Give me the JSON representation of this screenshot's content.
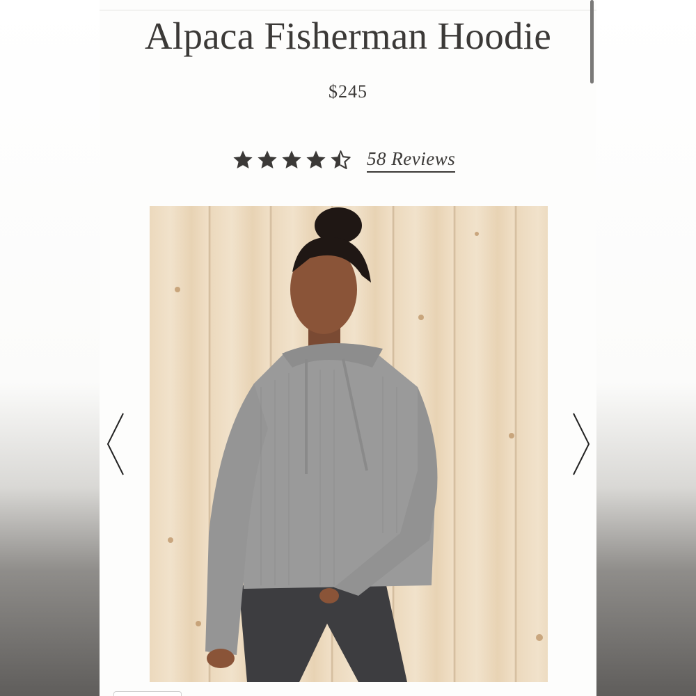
{
  "product": {
    "title": "Alpaca Fisherman Hoodie",
    "price": "$245",
    "rating": 4.5,
    "rating_max": 5,
    "reviews_label": "58 Reviews"
  },
  "gallery": {
    "prev_icon": "chevron-left-icon",
    "next_icon": "chevron-right-icon"
  },
  "colors": {
    "text": "#3b3937",
    "star": "#3b3937",
    "sweater": "#9a9a9a",
    "wood": "#ecd9bd"
  }
}
